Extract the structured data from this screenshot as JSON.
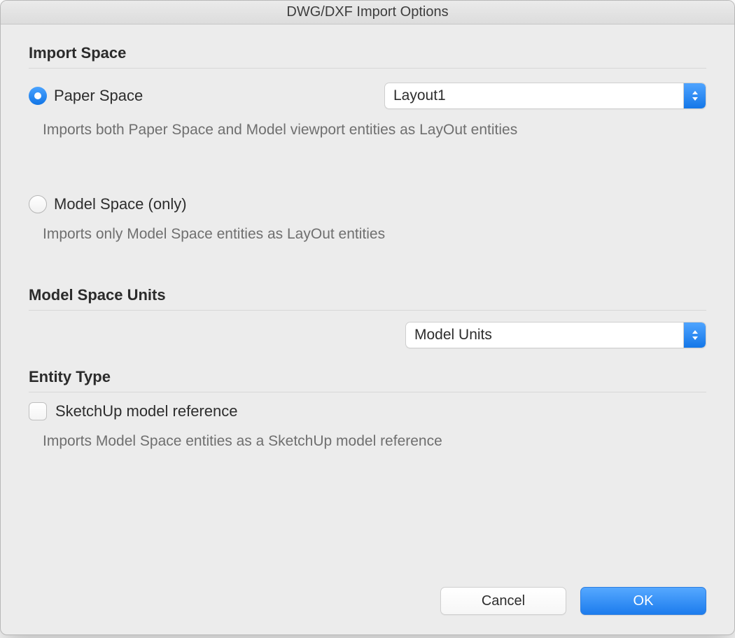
{
  "window": {
    "title": "DWG/DXF Import Options"
  },
  "importSpace": {
    "heading": "Import Space",
    "paperSpace": {
      "label": "Paper Space",
      "layoutSelect": "Layout1",
      "description": "Imports both Paper Space and Model viewport entities as LayOut entities"
    },
    "modelSpace": {
      "label": "Model Space (only)",
      "description": "Imports only Model Space entities as LayOut entities"
    }
  },
  "modelSpaceUnits": {
    "heading": "Model Space Units",
    "select": "Model Units"
  },
  "entityType": {
    "heading": "Entity Type",
    "checkboxLabel": "SketchUp model reference",
    "description": "Imports Model Space entities as a SketchUp model reference"
  },
  "buttons": {
    "cancel": "Cancel",
    "ok": "OK"
  }
}
